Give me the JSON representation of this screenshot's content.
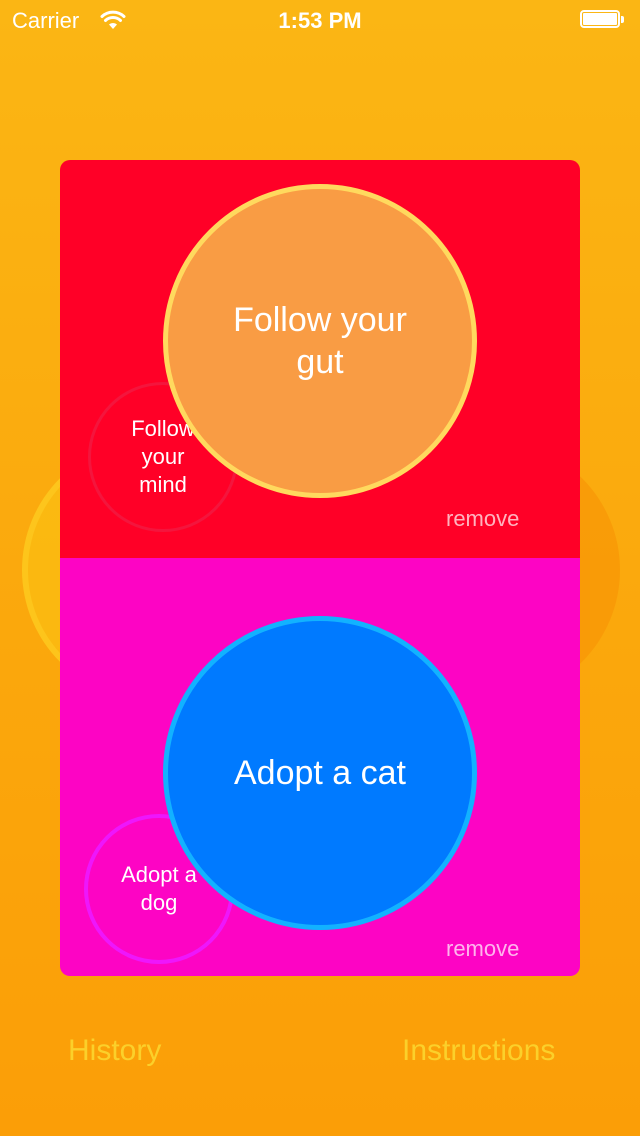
{
  "status_bar": {
    "carrier": "Carrier",
    "time": "1:53 PM"
  },
  "cards": {
    "top": {
      "main_choice": "Follow your gut",
      "alternate_choice": "Follow your mind",
      "remove_label": "remove"
    },
    "bottom": {
      "main_choice": "Adopt a cat",
      "alternate_choice": "Adopt a dog",
      "remove_label": "remove"
    }
  },
  "footer": {
    "history_label": "History",
    "instructions_label": "Instructions"
  },
  "colors": {
    "background": "#fbb614",
    "top_panel": "#ff0027",
    "bottom_panel": "#fd04c4",
    "gut_circle": "#f99c44",
    "cat_circle": "#007aff"
  }
}
